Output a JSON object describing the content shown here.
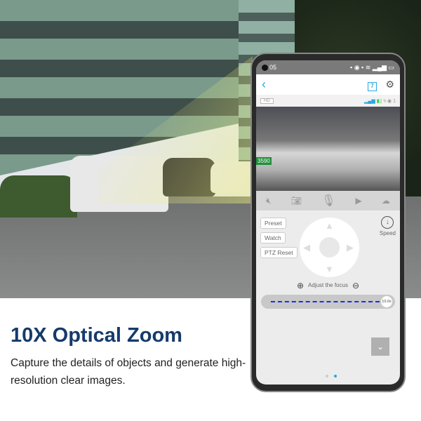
{
  "marketing": {
    "headline": "10X Optical Zoom",
    "subtext": "Capture the details of objects and generate high-resolution clear images."
  },
  "phone": {
    "status_time": "05",
    "header": {
      "back_icon": "chevron-left-icon",
      "calendar_day": "7",
      "settings_icon": "gear-icon"
    },
    "info_bar": {
      "quality": "HD",
      "viewers": "1"
    },
    "video": {
      "plate": "3590"
    },
    "toolbar": [
      "mute-icon",
      "snapshot-icon",
      "microphone-icon",
      "record-icon",
      "cloud-icon"
    ],
    "controls": {
      "preset": "Preset",
      "watch": "Watch",
      "ptz_reset": "PTZ Reset",
      "speed": "Speed",
      "focus_label": "Adjust the focus",
      "zoom_value": "10.0x",
      "zoom_fraction": 1.0
    },
    "pagination": {
      "pages": 2,
      "active": 2
    },
    "accent": "#2aa7e0"
  }
}
